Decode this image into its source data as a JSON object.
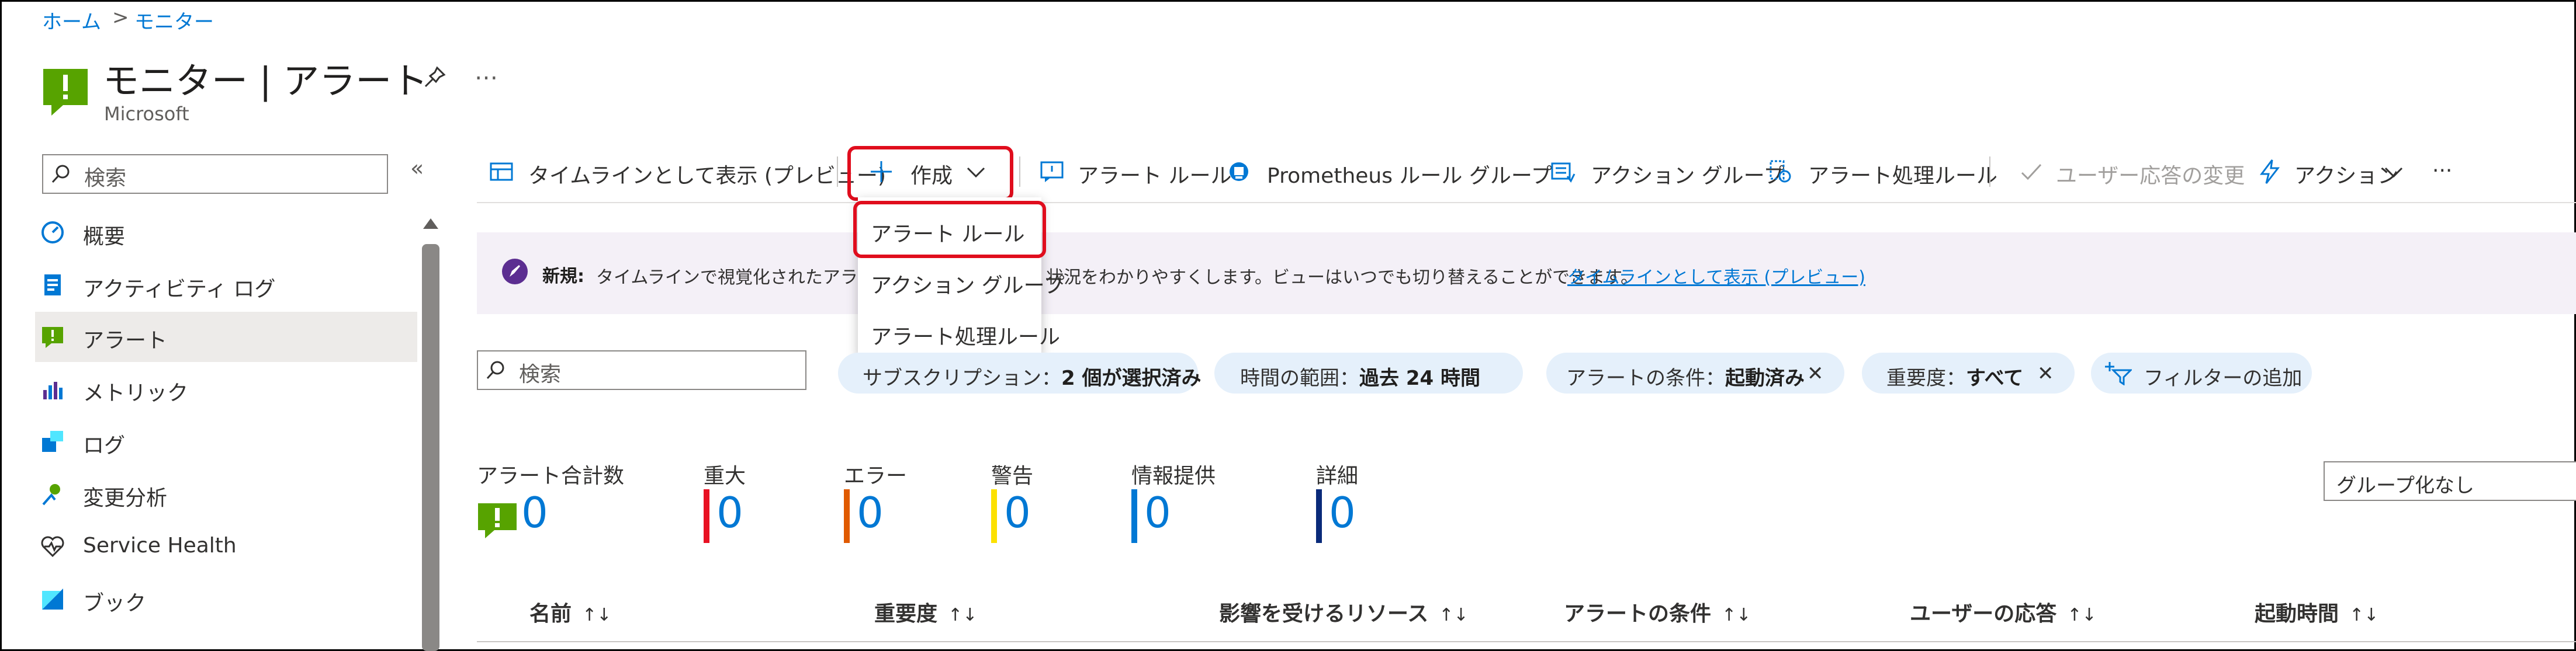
{
  "breadcrumb": {
    "home": "ホーム",
    "separator": ">",
    "monitor": "モニター"
  },
  "header": {
    "title": "モニター | アラート",
    "subtitle": "Microsoft",
    "pin_icon": "pin-icon",
    "more": "…"
  },
  "sidebar": {
    "search_placeholder": "検索",
    "collapse": "«",
    "items": [
      {
        "label": "概要",
        "icon": "overview-icon"
      },
      {
        "label": "アクティビティ ログ",
        "icon": "activity-log-icon"
      },
      {
        "label": "アラート",
        "icon": "alert-icon",
        "selected": true
      },
      {
        "label": "メトリック",
        "icon": "metrics-icon"
      },
      {
        "label": "ログ",
        "icon": "logs-icon"
      },
      {
        "label": "変更分析",
        "icon": "change-analysis-icon"
      },
      {
        "label": "Service Health",
        "icon": "heart-icon"
      },
      {
        "label": "ブック",
        "icon": "workbook-icon"
      }
    ]
  },
  "toolbar": {
    "timeline": "タイムラインとして表示 (プレビュー)",
    "create": "作成",
    "alert_rule": "アラート ルール",
    "prometheus": "Prometheus ルール グループ",
    "action_group": "アクション グループ",
    "processing_rule": "アラート処理ルール",
    "user_response": "ユーザー応答の変更",
    "actions": "アクション",
    "more": "···"
  },
  "create_menu": {
    "items": [
      "アラート ルール",
      "アクション グループ",
      "アラート処理ルール"
    ]
  },
  "banner": {
    "new_label": "新規:",
    "text_left": "タイムラインで視覚化されたアラー",
    "text_right": "状況をわかりやすくします。ビューはいつでも切り替えることができます。",
    "link": "タイムラインとして表示 (プレビュー)"
  },
  "filters": {
    "search_placeholder": "検索",
    "subscription_label": "サブスクリプション：",
    "subscription_value": "2 個が選択済み",
    "time_label": "時間の範囲：",
    "time_value": "過去 24 時間",
    "condition_label": "アラートの条件：",
    "condition_value": "起動済み",
    "severity_label": "重要度：",
    "severity_value": "すべて",
    "add_filter": "フィルターの追加",
    "close_glyph": "✕"
  },
  "summary": {
    "total_label": "アラート合計数",
    "total_value": "0",
    "items": [
      {
        "label": "重大",
        "value": "0",
        "color": "#e81123"
      },
      {
        "label": "エラー",
        "value": "0",
        "color": "#e05a00"
      },
      {
        "label": "警告",
        "value": "0",
        "color": "#fce100"
      },
      {
        "label": "情報提供",
        "value": "0",
        "color": "#0078d4"
      },
      {
        "label": "詳細",
        "value": "0",
        "color": "#0a2a7a"
      }
    ]
  },
  "grouping": {
    "selected": "グループ化なし"
  },
  "table": {
    "sort_glyph": "↑↓",
    "columns": [
      "名前",
      "重要度",
      "影響を受けるリソース",
      "アラートの条件",
      "ユーザーの応答",
      "起動時間"
    ]
  },
  "colors": {
    "accent": "#0078d4",
    "highlight": "#e00d1d",
    "alert_green": "#57a300"
  }
}
